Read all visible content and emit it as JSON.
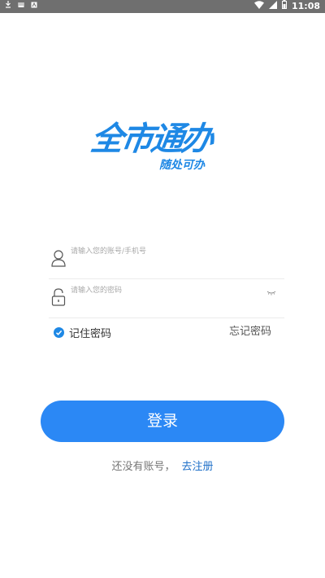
{
  "status_bar": {
    "time": "11:08",
    "left_icons": [
      "download-icon",
      "message-icon",
      "app-notification-icon"
    ],
    "right_icons": [
      "wifi-icon",
      "signal-icon",
      "battery-icon"
    ]
  },
  "logo": {
    "title": "全市通办",
    "slogan": "随处可办"
  },
  "form": {
    "account_placeholder": "请输入您的账号/手机号",
    "account_value": "",
    "password_placeholder": "请输入您的密码",
    "password_value": "",
    "remember_label": "记住密码",
    "remember_checked": true,
    "forgot_label": "忘记密码"
  },
  "login_button": {
    "label": "登录"
  },
  "register": {
    "prompt": "还没有账号，",
    "link_label": "去注册"
  },
  "colors": {
    "brand_blue": "#2b88f5",
    "status_bar_gray": "#6f6f6f",
    "link_blue": "#1e6fc8"
  }
}
